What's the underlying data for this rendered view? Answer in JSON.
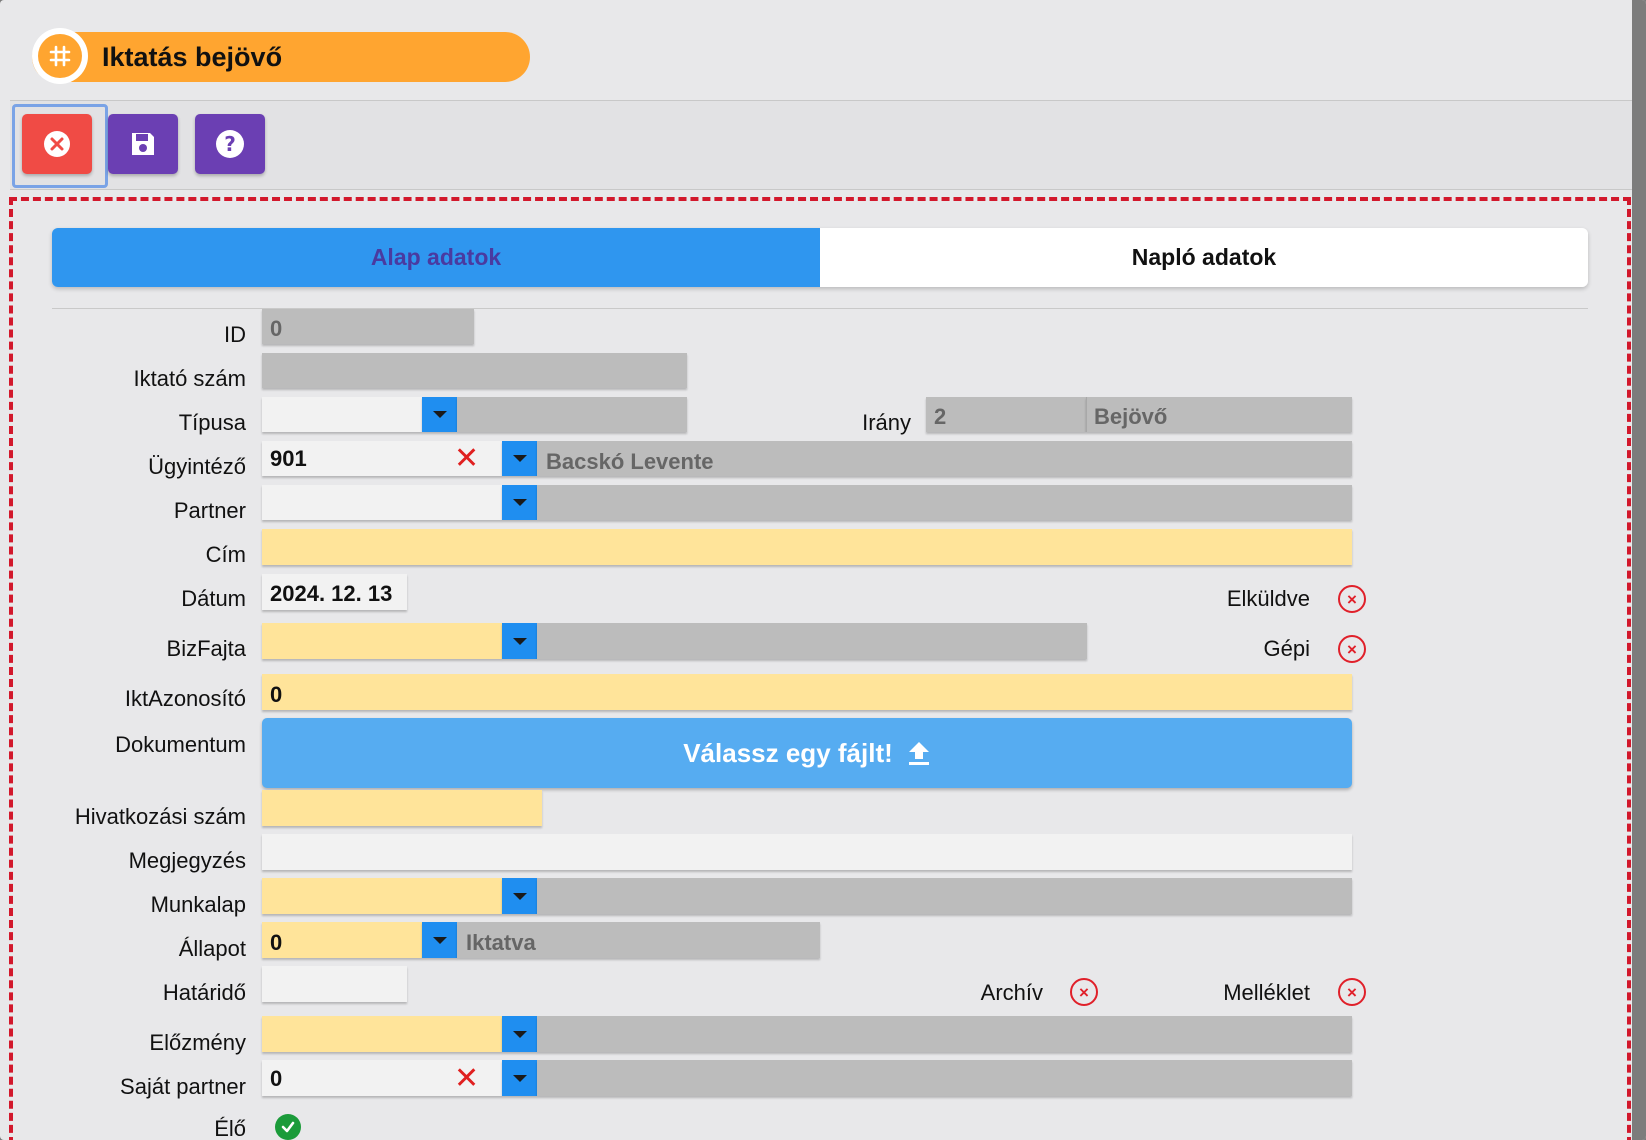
{
  "header": {
    "title": "Iktatás bejövő",
    "icon": "hash-icon"
  },
  "toolbar": {
    "buttons": [
      {
        "name": "cancel",
        "icon": "close-circle-icon",
        "color": "#f04b45"
      },
      {
        "name": "save",
        "icon": "floppy-icon",
        "color": "#6b3fb3"
      },
      {
        "name": "help",
        "icon": "question-icon",
        "color": "#6b3fb3"
      }
    ]
  },
  "tabs": [
    {
      "label": "Alap adatok",
      "active": true
    },
    {
      "label": "Napló adatok",
      "active": false
    }
  ],
  "form": {
    "id": {
      "label": "ID",
      "value": "0"
    },
    "iktato_szam": {
      "label": "Iktató szám",
      "value": ""
    },
    "tipusa": {
      "label": "Típusa",
      "value": ""
    },
    "irany": {
      "label": "Irány",
      "code": "2",
      "text": "Bejövő"
    },
    "ugyintezo": {
      "label": "Ügyintéző",
      "code": "901",
      "name": "Bacskó Levente"
    },
    "partner": {
      "label": "Partner",
      "value": ""
    },
    "cim": {
      "label": "Cím",
      "value": ""
    },
    "datum": {
      "label": "Dátum",
      "value": "2024. 12. 13"
    },
    "elkuldve": {
      "label": "Elküldve",
      "checked": false
    },
    "bizfajta": {
      "label": "BizFajta",
      "value": ""
    },
    "gepi": {
      "label": "Gépi",
      "checked": false
    },
    "iktazonosito": {
      "label": "IktAzonosító",
      "value": "0"
    },
    "dokumentum": {
      "label": "Dokumentum",
      "upload_label": "Válassz egy fájlt!",
      "icon": "upload-icon"
    },
    "hivatkozasi_szam": {
      "label": "Hivatkozási szám",
      "value": ""
    },
    "megjegyzes": {
      "label": "Megjegyzés",
      "value": ""
    },
    "munkalap": {
      "label": "Munkalap",
      "value": ""
    },
    "allapot": {
      "label": "Állapot",
      "code": "0",
      "text": "Iktatva"
    },
    "hatarido": {
      "label": "Határidő",
      "value": ""
    },
    "archiv": {
      "label": "Archív",
      "checked": false
    },
    "melleklet": {
      "label": "Melléklet",
      "checked": false
    },
    "elozmeny": {
      "label": "Előzmény",
      "value": ""
    },
    "sajat_partner": {
      "label": "Saját partner",
      "code": "0"
    },
    "elo": {
      "label": "Élő",
      "checked": true
    }
  },
  "colors": {
    "accent_orange": "#ffa530",
    "tab_active": "#2f96ef",
    "required_field": "#ffe49a",
    "readonly_field": "#bcbcbc",
    "dashed_border": "#d2182c"
  }
}
